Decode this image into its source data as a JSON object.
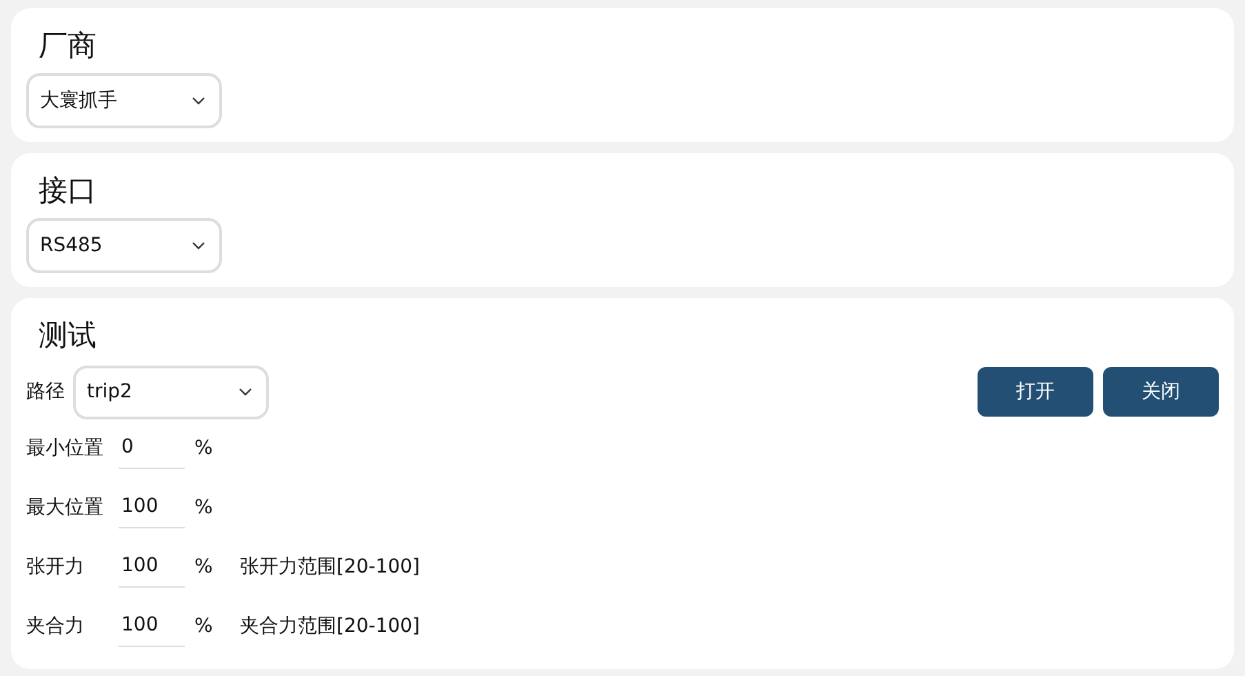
{
  "sections": [
    {
      "title": "厂商",
      "dropdown": {
        "value": "大寰抓手"
      }
    },
    {
      "title": "接口",
      "dropdown": {
        "value": "RS485"
      }
    },
    {
      "title": "测试",
      "path": {
        "label": "路径",
        "value": "trip2"
      },
      "buttons": [
        "打开",
        "关闭"
      ],
      "fields": [
        {
          "label": "最小位置",
          "value": "0",
          "unit": "%"
        },
        {
          "label": "最大位置",
          "value": "100",
          "unit": "%"
        },
        {
          "label": "张开力",
          "value": "100",
          "unit": "%",
          "hint": "张开力范围[20-100]"
        },
        {
          "label": "夹合力",
          "value": "100",
          "unit": "%",
          "hint": "夹合力范围[20-100]"
        }
      ]
    }
  ]
}
